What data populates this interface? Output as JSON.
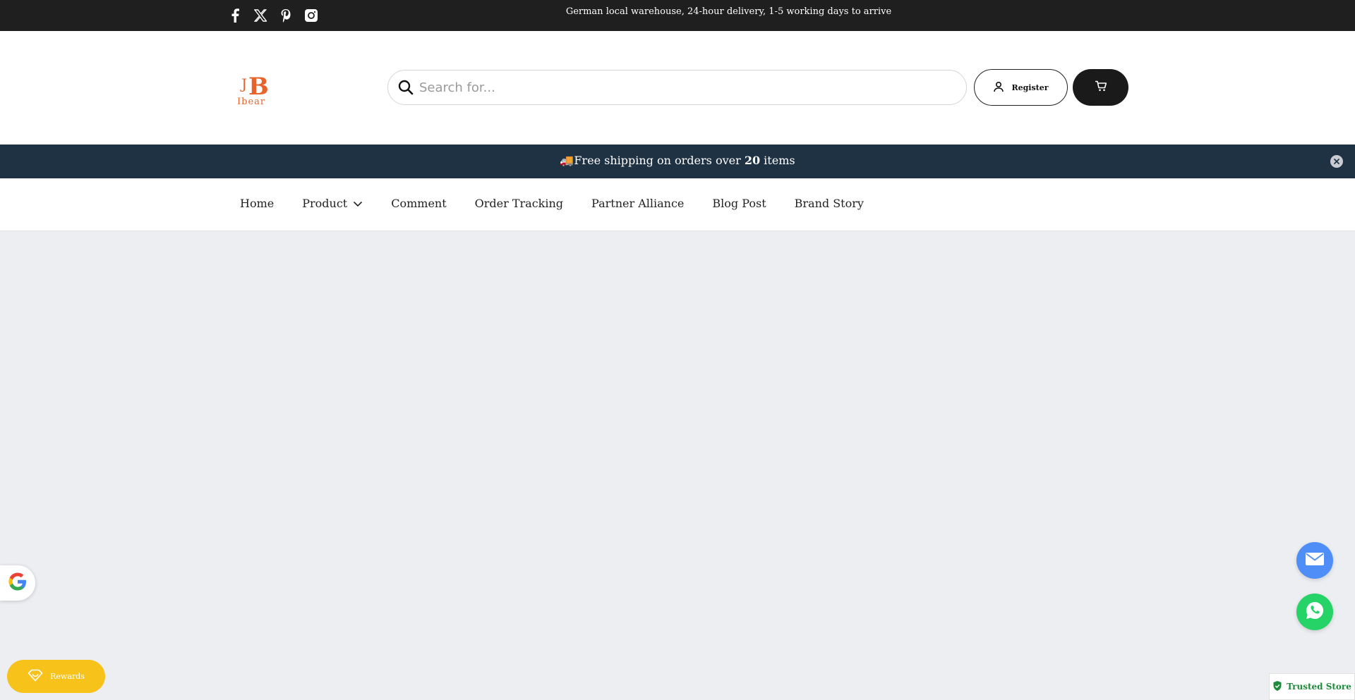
{
  "topbar": {
    "social_icons": [
      "facebook-icon",
      "x-twitter-icon",
      "pinterest-icon",
      "instagram-icon"
    ],
    "announcement": "German local warehouse, 24-hour delivery, 1-5 working days to arrive"
  },
  "header": {
    "logo_text": "Ibear",
    "search_placeholder": "Search for...",
    "search_value": "",
    "register_label": "Register",
    "cart_icon": "cart-icon"
  },
  "shipping_bar": {
    "emoji": "🚚",
    "text_before": "Free shipping on orders over ",
    "amount": "20",
    "text_after": " items",
    "close_icon": "close-icon"
  },
  "nav": {
    "items": [
      {
        "label": "Home"
      },
      {
        "label": "Product"
      },
      {
        "label": "Comment"
      },
      {
        "label": "Order Tracking"
      },
      {
        "label": "Partner Alliance"
      },
      {
        "label": "Blog Post"
      },
      {
        "label": "Brand Story"
      }
    ]
  },
  "widgets": {
    "rewards_label": "Rewards",
    "trusted_label": "Trusted Store"
  },
  "colors": {
    "topbar_bg": "#1f1f1f",
    "shipping_bar_bg": "#1f3244",
    "logo_accent": "#e8632b",
    "rewards_bg": "#f7c21a",
    "mail_fab": "#4f8ef7",
    "whatsapp_fab": "#25d366",
    "trusted_green": "#1e8c3a",
    "page_bg": "#eceef2"
  }
}
